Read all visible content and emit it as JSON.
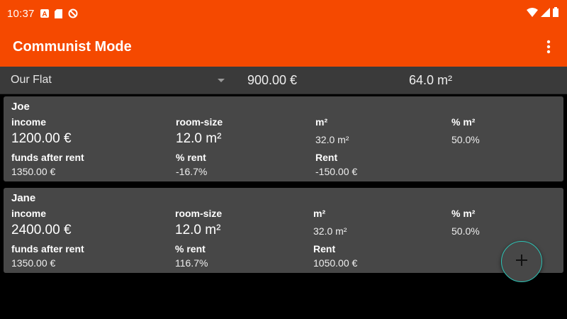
{
  "status_bar": {
    "time": "10:37",
    "left_icons": [
      "a-icon",
      "sd-card-icon",
      "do-not-disturb-icon"
    ],
    "right_icons": [
      "wifi-icon",
      "signal-icon",
      "battery-icon"
    ]
  },
  "app_bar": {
    "title": "Communist Mode",
    "overflow_icon": "more-vert-icon",
    "color": "#f54900"
  },
  "flat": {
    "name": "Our Flat",
    "total_rent": "900.00 €",
    "total_size": "64.0 m²"
  },
  "labels": {
    "income": "income",
    "room_size": "room-size",
    "m2": "m²",
    "pct_m2": "% m²",
    "funds_after_rent": "funds after rent",
    "pct_rent": "% rent",
    "rent": "Rent"
  },
  "persons": [
    {
      "name": "Joe",
      "income": "1200.00 €",
      "room_size": "12.0 m²",
      "m2": "32.0 m²",
      "pct_m2": "50.0%",
      "funds_after_rent": "1350.00 €",
      "pct_rent": "-16.7%",
      "rent": "-150.00 €"
    },
    {
      "name": "Jane",
      "income": "2400.00 €",
      "room_size": "12.0 m²",
      "m2": "32.0 m²",
      "pct_m2": "50.0%",
      "funds_after_rent": "1350.00 €",
      "pct_rent": "116.7%",
      "rent": "1050.00 €"
    }
  ],
  "fab": {
    "icon": "plus-icon",
    "accent": "#2ec4b6"
  }
}
